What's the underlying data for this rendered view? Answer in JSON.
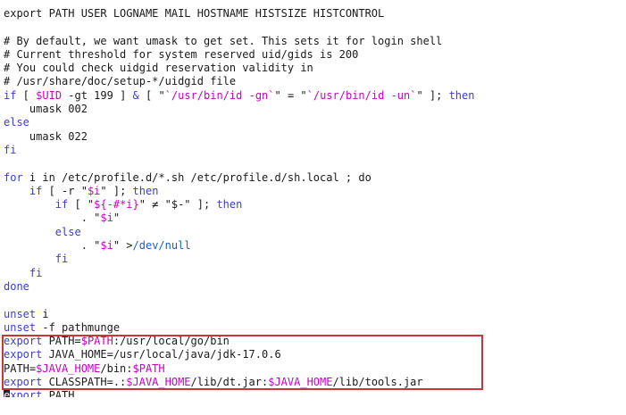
{
  "lines": [
    [
      {
        "t": "export PATH USER LOGNAME MAIL HOSTNAME HISTSIZE HISTCONTROL",
        "c": "plain"
      }
    ],
    [
      {
        "t": "",
        "c": "plain"
      }
    ],
    [
      {
        "t": "# By default, we want umask to get set. This sets it for login shell",
        "c": "plain"
      }
    ],
    [
      {
        "t": "# Current threshold for system reserved uid/gids is 200",
        "c": "plain"
      }
    ],
    [
      {
        "t": "# You could check uidgid reservation validity in",
        "c": "plain"
      }
    ],
    [
      {
        "t": "# /usr/share/doc/setup-*/uidgid file",
        "c": "plain"
      }
    ],
    [
      {
        "t": "if",
        "c": "kw"
      },
      {
        "t": " [ ",
        "c": "plain"
      },
      {
        "t": "$UID",
        "c": "var"
      },
      {
        "t": " -gt 199 ] ",
        "c": "plain"
      },
      {
        "t": "&",
        "c": "kw"
      },
      {
        "t": " [ \"",
        "c": "plain"
      },
      {
        "t": "`/usr/bin/id -gn`",
        "c": "str"
      },
      {
        "t": "\" = \"",
        "c": "plain"
      },
      {
        "t": "`/usr/bin/id -un`",
        "c": "str"
      },
      {
        "t": "\" ]; ",
        "c": "plain"
      },
      {
        "t": "then",
        "c": "kw"
      }
    ],
    [
      {
        "t": "    umask 002",
        "c": "plain"
      }
    ],
    [
      {
        "t": "else",
        "c": "kw"
      }
    ],
    [
      {
        "t": "    umask 022",
        "c": "plain"
      }
    ],
    [
      {
        "t": "fi",
        "c": "kw"
      }
    ],
    [
      {
        "t": "",
        "c": "plain"
      }
    ],
    [
      {
        "t": "for",
        "c": "kw"
      },
      {
        "t": " i in /etc/profile.d/*.sh /etc/profile.d/sh.local ; do",
        "c": "plain"
      }
    ],
    [
      {
        "t": "    ",
        "c": "plain"
      },
      {
        "t": "if",
        "c": "kw"
      },
      {
        "t": " [ -r \"",
        "c": "plain"
      },
      {
        "t": "$i",
        "c": "var"
      },
      {
        "t": "\" ]; ",
        "c": "plain"
      },
      {
        "t": "then",
        "c": "kw"
      }
    ],
    [
      {
        "t": "        ",
        "c": "plain"
      },
      {
        "t": "if",
        "c": "kw"
      },
      {
        "t": " [ \"",
        "c": "plain"
      },
      {
        "t": "${-#*i}",
        "c": "var"
      },
      {
        "t": "\" ≠ \"$-\" ]; ",
        "c": "plain"
      },
      {
        "t": "then",
        "c": "kw"
      }
    ],
    [
      {
        "t": "            . \"",
        "c": "plain"
      },
      {
        "t": "$i",
        "c": "var"
      },
      {
        "t": "\"",
        "c": "plain"
      }
    ],
    [
      {
        "t": "        ",
        "c": "plain"
      },
      {
        "t": "else",
        "c": "kw"
      }
    ],
    [
      {
        "t": "            . \"",
        "c": "plain"
      },
      {
        "t": "$i",
        "c": "var"
      },
      {
        "t": "\" >",
        "c": "plain"
      },
      {
        "t": "/dev/null",
        "c": "path"
      }
    ],
    [
      {
        "t": "        ",
        "c": "plain"
      },
      {
        "t": "fi",
        "c": "kw"
      }
    ],
    [
      {
        "t": "    ",
        "c": "plain"
      },
      {
        "t": "fi",
        "c": "kw"
      }
    ],
    [
      {
        "t": "done",
        "c": "kw"
      }
    ],
    [
      {
        "t": "",
        "c": "plain"
      }
    ],
    [
      {
        "t": "unset",
        "c": "kw"
      },
      {
        "t": " i",
        "c": "plain"
      }
    ],
    [
      {
        "t": "unset",
        "c": "kw"
      },
      {
        "t": " -f pathmunge",
        "c": "plain"
      }
    ],
    [
      {
        "t": "export",
        "c": "kw"
      },
      {
        "t": " PATH=",
        "c": "plain"
      },
      {
        "t": "$PATH",
        "c": "var"
      },
      {
        "t": ":/usr/local/go/bin",
        "c": "plain"
      }
    ],
    [
      {
        "t": "export",
        "c": "kw"
      },
      {
        "t": " JAVA_HOME=/usr/local/java/jdk-17.0.6",
        "c": "plain"
      }
    ],
    [
      {
        "t": "PATH=",
        "c": "plain"
      },
      {
        "t": "$JAVA_HOME",
        "c": "var"
      },
      {
        "t": "/bin:",
        "c": "plain"
      },
      {
        "t": "$PATH",
        "c": "var"
      }
    ],
    [
      {
        "t": "export",
        "c": "kw"
      },
      {
        "t": " CLASSPATH=.:",
        "c": "plain"
      },
      {
        "t": "$JAVA_HOME",
        "c": "var"
      },
      {
        "t": "/lib/dt.jar:",
        "c": "plain"
      },
      {
        "t": "$JAVA_HOME",
        "c": "var"
      },
      {
        "t": "/lib/tools.jar",
        "c": "plain"
      }
    ],
    [
      {
        "t": "e",
        "c": "cursor"
      },
      {
        "t": "xport",
        "c": "kw"
      },
      {
        "t": " PATH",
        "c": "plain"
      }
    ]
  ],
  "colors": {
    "keyword": "#3b3bd6",
    "variable": "#c800c8",
    "path": "#1f5fbf",
    "highlight_border": "#c8363c",
    "cursor": "#222222"
  }
}
